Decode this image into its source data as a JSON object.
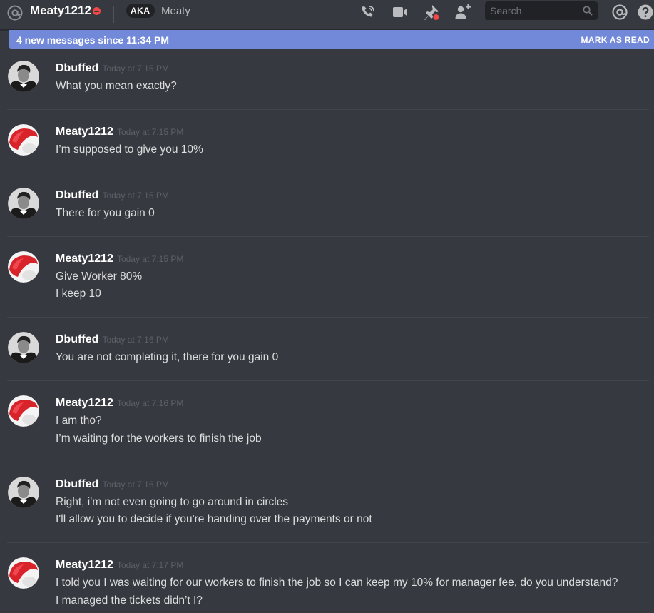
{
  "header": {
    "dm_name": "Meaty1212",
    "aka_badge": "AKA",
    "aka_name": "Meaty",
    "search_placeholder": "Search",
    "status_color": "#f04747"
  },
  "new_messages_bar": {
    "text": "4 new messages since 11:34 PM",
    "action": "MARK AS READ",
    "color": "#7289da"
  },
  "messages": [
    {
      "author": "Dbuffed",
      "time": "Today at 7:15 PM",
      "lines": [
        "What you mean exactly?"
      ]
    },
    {
      "author": "Meaty1212",
      "time": "Today at 7:15 PM",
      "lines": [
        "I’m supposed to give you 10%"
      ]
    },
    {
      "author": "Dbuffed",
      "time": "Today at 7:15 PM",
      "lines": [
        "There for you gain 0"
      ]
    },
    {
      "author": "Meaty1212",
      "time": "Today at 7:15 PM",
      "lines": [
        "Give Worker 80%",
        "I keep 10"
      ]
    },
    {
      "author": "Dbuffed",
      "time": "Today at 7:16 PM",
      "lines": [
        "You are not completing it, there for you gain 0"
      ]
    },
    {
      "author": "Meaty1212",
      "time": "Today at 7:16 PM",
      "lines": [
        "I am tho?",
        "I’m waiting for the workers to finish the job"
      ]
    },
    {
      "author": "Dbuffed",
      "time": "Today at 7:16 PM",
      "lines": [
        "Right, i'm not even going to go around in circles",
        "I'll allow you to decide if you're handing over the payments or not"
      ]
    },
    {
      "author": "Meaty1212",
      "time": "Today at 7:17 PM",
      "lines": [
        "I told you I was waiting for our workers to finish the job so I can keep my 10% for manager fee, do you understand?",
        "I managed the tickets didn’t I?"
      ]
    }
  ]
}
